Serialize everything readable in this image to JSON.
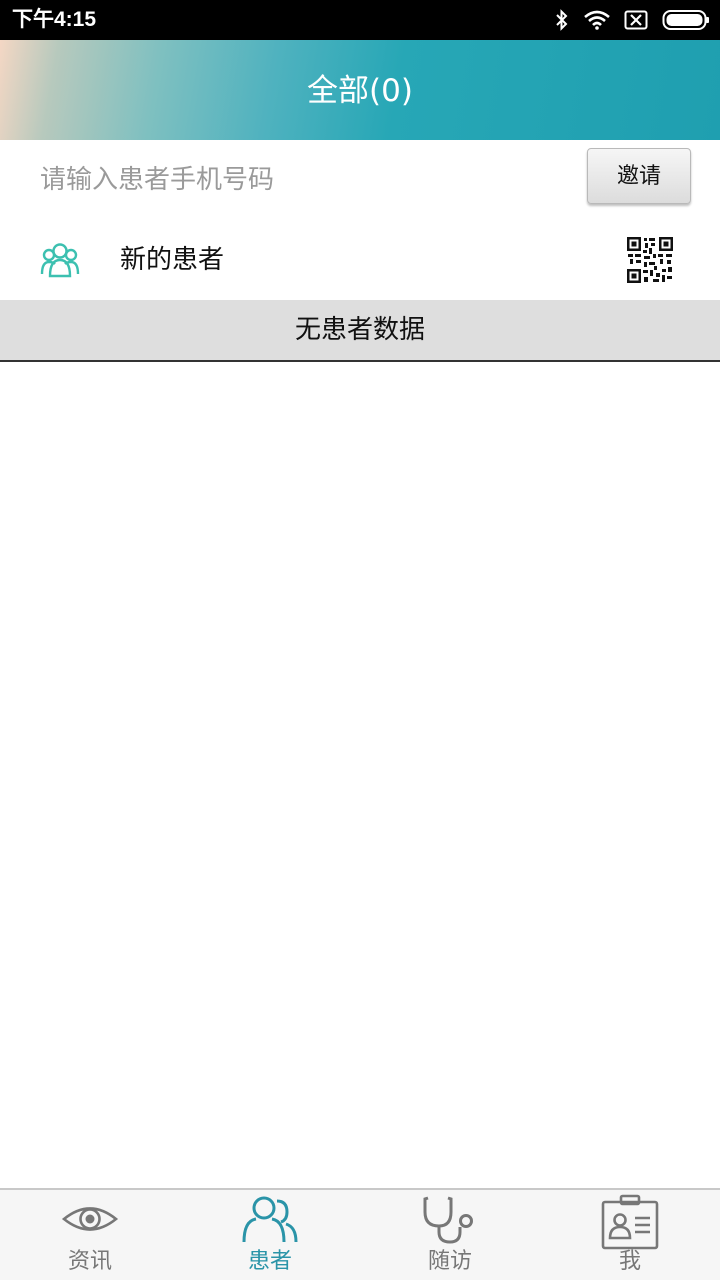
{
  "status_bar": {
    "time": "下午4:15"
  },
  "header": {
    "title": "全部(0)"
  },
  "invite": {
    "placeholder": "请输入患者手机号码",
    "value": "",
    "button_label": "邀请"
  },
  "new_patient": {
    "label": "新的患者"
  },
  "empty_state": {
    "text": "无患者数据"
  },
  "tabs": [
    {
      "label": "资讯",
      "icon": "eye-icon",
      "active": false
    },
    {
      "label": "患者",
      "icon": "patients-icon",
      "active": true
    },
    {
      "label": "随访",
      "icon": "stethoscope-icon",
      "active": false
    },
    {
      "label": "我",
      "icon": "id-card-icon",
      "active": false
    }
  ],
  "colors": {
    "accent": "#1f9fb0",
    "tab_inactive": "#777777",
    "tab_active": "#2a94a8",
    "icon_teal": "#3cc0b0"
  }
}
